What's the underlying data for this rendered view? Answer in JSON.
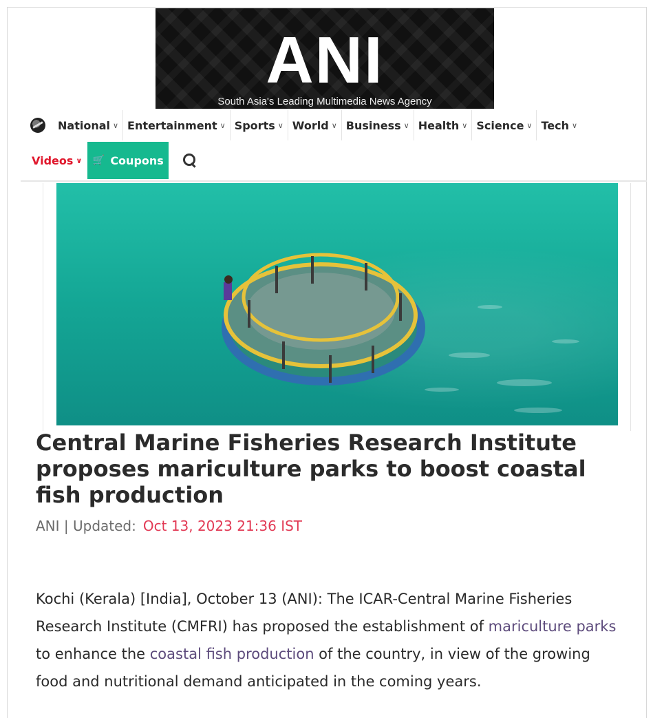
{
  "logo": {
    "text": "ANI",
    "tagline": "South Asia's Leading Multimedia News Agency"
  },
  "nav": {
    "items": [
      {
        "label": "National"
      },
      {
        "label": "Entertainment"
      },
      {
        "label": "Sports"
      },
      {
        "label": "World"
      },
      {
        "label": "Business"
      },
      {
        "label": "Health"
      },
      {
        "label": "Science"
      },
      {
        "label": "Tech"
      }
    ],
    "videos_label": "Videos",
    "coupons_label": "Coupons"
  },
  "article": {
    "headline": "Central Marine Fisheries Research Institute proposes mariculture parks to boost coastal fish production",
    "source": "ANI | Updated:",
    "date": "Oct 13, 2023 21:36 IST",
    "body": {
      "part1": "Kochi (Kerala) [India], October 13 (ANI): The ICAR-Central Marine Fisheries Research Institute (CMFRI) has proposed the establishment of ",
      "link1": "mariculture parks",
      "part2": " to enhance the ",
      "link2": "coastal fish production",
      "part3": " of the country, in view of the growing food and nutritional demand anticipated in the coming years."
    }
  },
  "colors": {
    "accent_red": "#e0182d",
    "coupons_green": "#16b98f",
    "date_pink": "#e23a55",
    "link_purple": "#5d4b7c"
  }
}
